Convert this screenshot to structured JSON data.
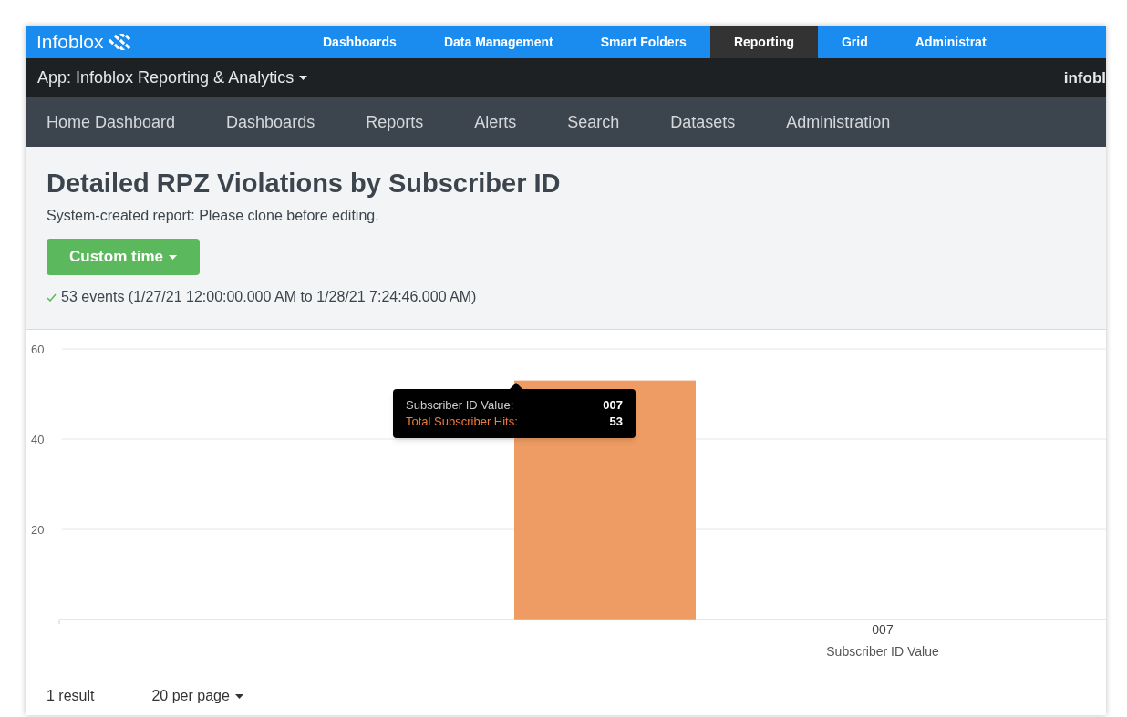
{
  "top_nav": {
    "logo": "Infoblox",
    "items": [
      {
        "label": "Dashboards",
        "selected": false
      },
      {
        "label": "Data Management",
        "selected": false
      },
      {
        "label": "Smart Folders",
        "selected": false
      },
      {
        "label": "Reporting",
        "selected": true
      },
      {
        "label": "Grid",
        "selected": false
      },
      {
        "label": "Administrat",
        "selected": false
      }
    ]
  },
  "app_bar": {
    "app": "App: Infoblox Reporting & Analytics",
    "user": "infobl"
  },
  "app_nav": {
    "items": [
      "Home Dashboard",
      "Dashboards",
      "Reports",
      "Alerts",
      "Search",
      "Datasets",
      "Administration"
    ]
  },
  "report": {
    "title": "Detailed RPZ Violations by Subscriber ID",
    "subtitle": "System-created report: Please clone before editing.",
    "time_button": "Custom time",
    "events": "53 events (1/27/21 12:00:00.000 AM to 1/28/21 7:24:46.000 AM)"
  },
  "chart": {
    "chart_data": {
      "type": "bar",
      "xlabel": "Subscriber ID Value",
      "categories": [
        "007"
      ],
      "series": [
        {
          "color": "#ee9c63",
          "values": [
            53
          ]
        }
      ],
      "ylim": [
        0,
        60
      ],
      "yticks": [
        20,
        40,
        60
      ]
    },
    "tooltip": {
      "rows": [
        {
          "label": "Subscriber ID Value:",
          "value": "007",
          "kind": "plain"
        },
        {
          "label": "Total Subscriber Hits:",
          "value": "53",
          "kind": "series"
        }
      ]
    }
  },
  "footer": {
    "results": "1 result",
    "per_page": "20 per page"
  }
}
